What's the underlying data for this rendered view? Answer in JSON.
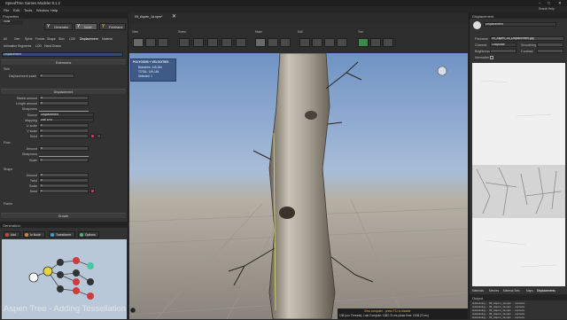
{
  "window": {
    "title": "SpeedTree Games Modeler 8.1.2",
    "controls": [
      "–",
      "□",
      "✕"
    ]
  },
  "menu": [
    "File",
    "Edit",
    "Tools",
    "Window",
    "Help"
  ],
  "properties": {
    "header": "Properties",
    "node": "Trunk",
    "modes": [
      {
        "label": "Generator",
        "icon": "Y"
      },
      {
        "label": "Node",
        "icon": "Y"
      },
      {
        "label": "Freehand",
        "icon": "Y"
      }
    ],
    "tabs_row1": [
      "All",
      "Gen",
      "Spine",
      "Forces",
      "Shape",
      "Skin",
      "LOD",
      "Displacement",
      "Material"
    ],
    "tabs_row2": [
      "Animation",
      "Segments",
      "LOD",
      "Hand Drawn"
    ],
    "selected_section": "Displacement",
    "extensions_header": "Extensions",
    "skin_label": "Skin",
    "skin_rows": [
      {
        "label": "Displacement scale",
        "value": "1"
      }
    ],
    "displacement_header": "Displacement",
    "disp_rows": [
      {
        "label": "Radial amount",
        "value": "0"
      },
      {
        "label": "Length amount",
        "value": "0"
      },
      {
        "label": "Sharpness",
        "value": ""
      },
      {
        "label": "Source",
        "value": "Displacement"
      },
      {
        "label": "Mapping",
        "value": "Use UVs"
      },
      {
        "label": "U scale",
        "value": "1"
      },
      {
        "label": "V scale",
        "value": "1"
      },
      {
        "label": "Seed",
        "value": "1"
      }
    ],
    "flow_label": "Flow",
    "flow_rows": [
      {
        "label": "Amount",
        "value": "0"
      },
      {
        "label": "Sharpness",
        "value": ""
      },
      {
        "label": "Scale",
        "value": "1"
      }
    ],
    "shape_label": "Shape",
    "shape_rows": [
      {
        "label": "Amount",
        "value": "0"
      },
      {
        "label": "Twist",
        "value": "0"
      },
      {
        "label": "Scale",
        "value": "1"
      },
      {
        "label": "Seed",
        "value": "1"
      }
    ],
    "flares_label": "Flares",
    "growth_header": "Growth"
  },
  "generation": {
    "header": "Generation",
    "buttons": [
      {
        "label": "Add",
        "color": "#c84a3c"
      },
      {
        "label": "In Node",
        "color": "#d08a3a"
      },
      {
        "label": "Transfomer",
        "color": "#3aa0c8"
      },
      {
        "label": "Options",
        "color": "#5bb56a"
      }
    ]
  },
  "watermark": "Aspen Tree - Adding Tessellation",
  "viewport": {
    "tab": "09_Aspen_1a.spm*",
    "groups": [
      "View",
      "Scene",
      "Mode",
      "Edit",
      "Tool"
    ],
    "stats": {
      "title": "POLYGONS + VELOCITIES",
      "lines": [
        "Branches: 149,184",
        "TOTAL: 149,184",
        "Selected: 1"
      ]
    },
    "status": {
      "warning": "Slow computer - press F11 to disable",
      "info": "138 (our Threads). Last Compute: 1382.74 ms (draw time: 1006.22 ms)"
    }
  },
  "displacement_panel": {
    "header": "Displacement",
    "search_header": "Search Help",
    "dropdown": "Displacement",
    "filename_label": "Filename",
    "filename": "09_Aspen_1a_Displacement.jpg",
    "channel_label": "Channel",
    "channel": "Grayscale",
    "smoothing_label": "Smoothing",
    "brightness_label": "Brightness",
    "contrast_label": "Contrast",
    "normalize_label": "Normalize",
    "tabs": [
      "Materials",
      "Meshes",
      "Material Sets",
      "Maps",
      "Displacements"
    ],
    "output_header": "Output",
    "output_lines": [
      "Autosaving ... 09_Aspen_1a.spm ... success.",
      "Autosaving ... 09_Aspen_1a.spm ... success.",
      "Autosaving ... 09_Aspen_1a.spm ... success.",
      "Autosaving ... 09_Aspen_1a.spm ... success.",
      "Autosaving ... 09_Aspen_1a.spm ... success."
    ]
  },
  "colors": {
    "accent": "#3e5a86",
    "swatch": "#c8326e",
    "warning": "#e8b23a",
    "graph_bg": "#b9c8d8"
  }
}
